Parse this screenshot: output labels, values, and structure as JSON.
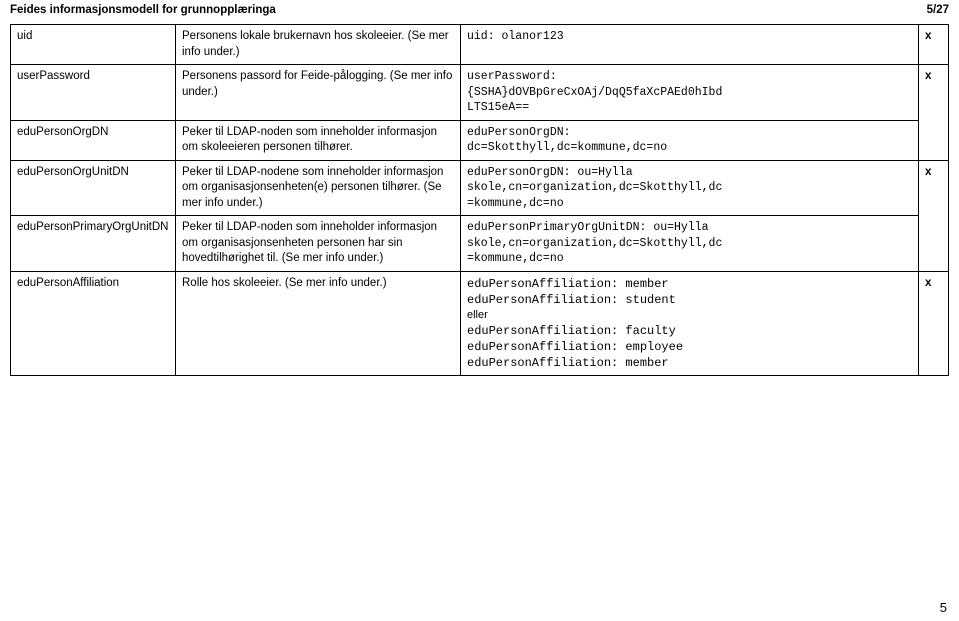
{
  "header": {
    "title": "Feides informasjonsmodell for grunnopplæringa",
    "pager": "5/27"
  },
  "rows": [
    {
      "attr": "uid",
      "desc": "Personens lokale brukernavn hos skoleeier. (Se mer info under.)",
      "example": "uid: olanor123",
      "flag": "x"
    },
    {
      "attr": "userPassword",
      "desc": "Personens passord for Feide-pålogging. (Se mer info under.)",
      "example": "userPassword:\n{SSHA}dOVBpGreCxOAj/DqQ5faXcPAEd0hIbd\nLTS15eA==",
      "flag": "x"
    },
    {
      "attr": "eduPersonOrgDN",
      "desc": "Peker til LDAP-noden som inneholder informasjon om skoleeieren personen tilhører.",
      "example": "eduPersonOrgDN:\ndc=Skotthyll,dc=kommune,dc=no",
      "flag": ""
    },
    {
      "attr": "eduPersonOrgUnitDN",
      "desc": "Peker til LDAP-nodene som inneholder informasjon om organisasjonsenheten(e) personen tilhører. (Se mer info under.)",
      "example": "eduPersonOrgDN: ou=Hylla\nskole,cn=organization,dc=Skotthyll,dc\n=kommune,dc=no",
      "flag": "x"
    },
    {
      "attr": "eduPersonPrimaryOrgUnitDN",
      "desc": "Peker til LDAP-noden som inneholder informasjon om organisasjonsenheten personen har sin hovedtilhørighet til. (Se mer info under.)",
      "example": "eduPersonPrimaryOrgUnitDN: ou=Hylla\nskole,cn=organization,dc=Skotthyll,dc\n=kommune,dc=no",
      "flag": ""
    },
    {
      "attr": "eduPersonAffiliation",
      "desc": "Rolle hos skoleeier. (Se mer info under.)",
      "example_lines_pre": [
        "eduPersonAffiliation: member",
        "eduPersonAffiliation: student"
      ],
      "example_mid": "eller",
      "example_lines_post": [
        "eduPersonAffiliation: faculty",
        "eduPersonAffiliation: employee",
        "eduPersonAffiliation: member"
      ],
      "flag": "x"
    }
  ],
  "footer": {
    "page_number": "5"
  }
}
